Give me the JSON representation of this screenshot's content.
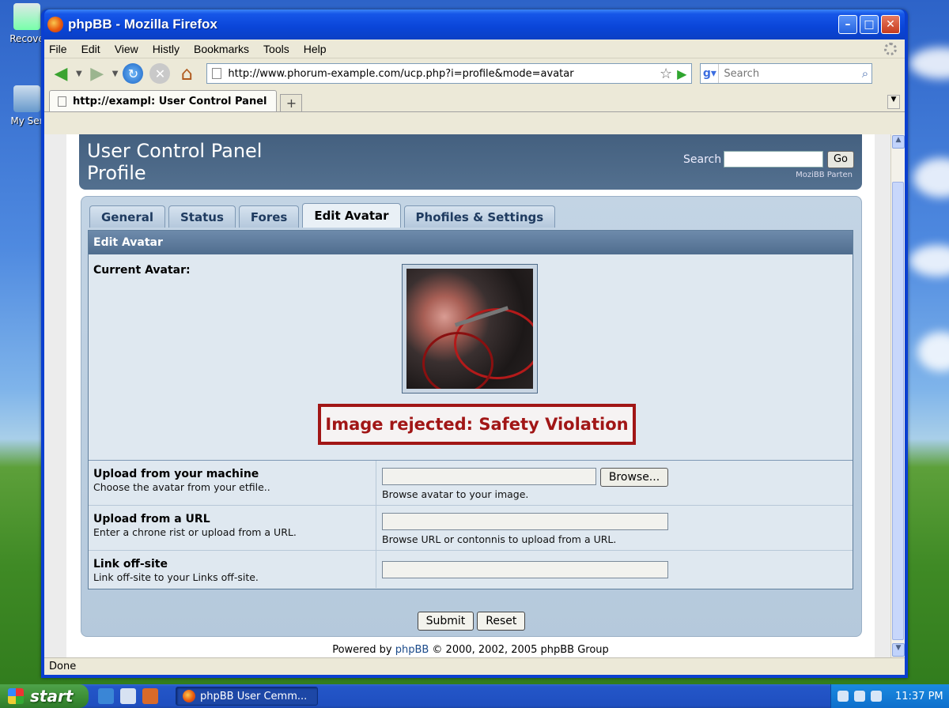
{
  "desktop": {
    "icons": [
      {
        "label": "Recove"
      },
      {
        "label": "My Ser"
      }
    ]
  },
  "window": {
    "title": "phpBB - Mozilla Firefox",
    "controls": {
      "minimize": "–",
      "maximize": "□",
      "close": "✕"
    }
  },
  "menu": [
    "File",
    "Edit",
    "View",
    "Histly",
    "Bookmarks",
    "Tools",
    "Help"
  ],
  "nav": {
    "url": "http://www.phorum-example.com/ucp.php?i=profile&mode=avatar",
    "search_placeholder": "Search"
  },
  "tabs": {
    "active_label": "http://exampl: User Control Panel",
    "new_tab": "+"
  },
  "page": {
    "header": {
      "title_line1": "User Control Panel",
      "title_line2": "Profile",
      "search_label": "Search",
      "go_label": "Go",
      "sub": "MoziBB Parten"
    },
    "panel_tabs": [
      {
        "label": "General",
        "active": false
      },
      {
        "label": "Status",
        "active": false
      },
      {
        "label": "Fores",
        "active": false
      },
      {
        "label": "Edit Avatar",
        "active": true
      },
      {
        "label": "Phofiles & Settings",
        "active": false
      }
    ],
    "box_title": "Edit Avatar",
    "current_avatar_label": "Current Avatar:",
    "rejection": "Image rejected: Safety Violation",
    "rows": [
      {
        "title": "Upload from your machine",
        "desc": "Choose the avatar from your etfile..",
        "help": "Browse avatar to your image.",
        "button": "Browse..."
      },
      {
        "title": "Upload from a URL",
        "desc": "Enter a chrone rist or upload from a URL.",
        "help": "Browse URL or contonnis to upload from a URL."
      },
      {
        "title": "Link off-site",
        "desc": "Link off-site to your Links off-site."
      }
    ],
    "submit": "Submit",
    "reset": "Reset",
    "footer": {
      "prefix": "Powered by ",
      "link": "phpBB",
      "suffix": " © 2000, 2002, 2005 phpBB Group"
    }
  },
  "status": "Done",
  "taskbar": {
    "start": "start",
    "task": "phpBB User Cemm...",
    "clock": "11:37 PM"
  },
  "colors": {
    "header_bg": "#4a6788",
    "reject_red": "#a11616",
    "xp_blue": "#0a3fd0"
  }
}
